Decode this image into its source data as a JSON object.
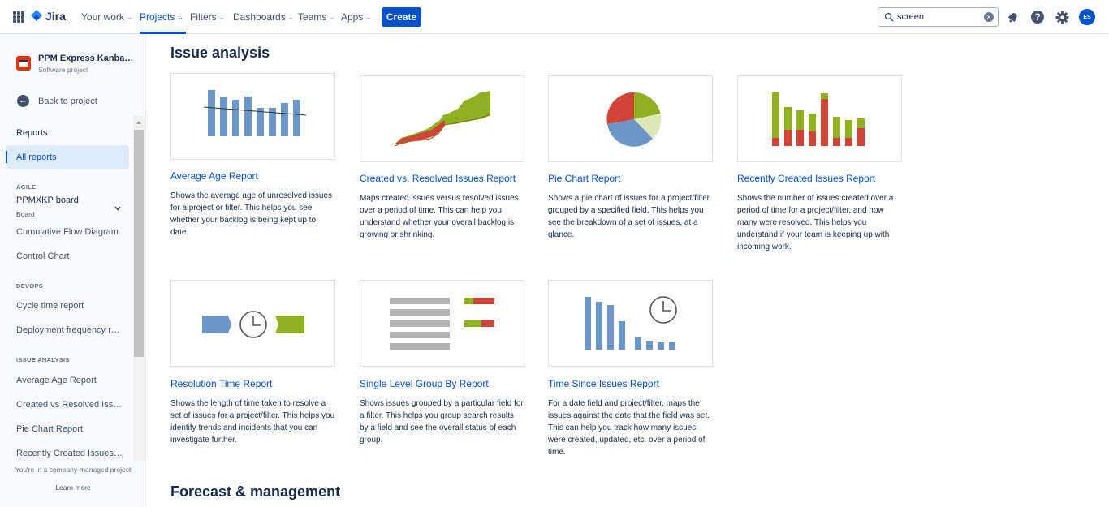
{
  "topnav": {
    "logo": "Jira",
    "items": [
      {
        "label": "Your work"
      },
      {
        "label": "Projects"
      },
      {
        "label": "Filters"
      },
      {
        "label": "Dashboards"
      },
      {
        "label": "Teams"
      },
      {
        "label": "Apps"
      }
    ],
    "active_item": "Projects",
    "create_label": "Create",
    "search_value": "screen",
    "avatar_initials": "ES",
    "colors": {
      "brand": "#0052cc",
      "text": "#42526e"
    }
  },
  "sidebar": {
    "project_name": "PPM Express Kanban Pr...",
    "project_type": "Software project",
    "back_label": "Back to project",
    "reports_label": "Reports",
    "all_reports_label": "All reports",
    "agile_heading": "AGILE",
    "board_name": "PPMXKP board",
    "board_type": "Board",
    "cumulative_flow": "Cumulative Flow Diagram",
    "control_chart": "Control Chart",
    "devops_heading": "DEVOPS",
    "cycle_time": "Cycle time report",
    "deployment_frequency": "Deployment frequency re...",
    "issue_analysis_heading": "ISSUE ANALYSIS",
    "average_age": "Average Age Report",
    "created_vs_resolved": "Created vs Resolved Issue...",
    "pie_chart": "Pie Chart Report",
    "recently_created": "Recently Created Issues Re...",
    "footer_text": "You're in a company-managed project",
    "learn_more": "Learn more"
  },
  "main": {
    "section_issue_analysis": "Issue analysis",
    "section_forecast": "Forecast & management",
    "cards": [
      {
        "title": "Average Age Report",
        "desc": "Shows the average age of unresolved issues for a project or filter. This helps you see whether your backlog is being kept up to date."
      },
      {
        "title": "Created vs. Resolved Issues Report",
        "desc": "Maps created issues versus resolved issues over a period of time. This can help you understand whether your overall backlog is growing or shrinking."
      },
      {
        "title": "Pie Chart Report",
        "desc": "Shows a pie chart of issues for a project/filter grouped by a specified field. This helps you see the breakdown of a set of issues, at a glance."
      },
      {
        "title": "Recently Created Issues Report",
        "desc": "Shows the number of issues created over a period of time for a project/filter, and how many were resolved. This helps you understand if your team is keeping up with incoming work."
      },
      {
        "title": "Resolution Time Report",
        "desc": "Shows the length of time taken to resolve a set of issues for a project/filter. This helps you identify trends and incidents that you can investigate further."
      },
      {
        "title": "Single Level Group By Report",
        "desc": "Shows issues grouped by a particular field for a filter. This helps you group search results by a field and see the overall status of each group."
      },
      {
        "title": "Time Since Issues Report",
        "desc": "For a date field and project/filter, maps the issues against the date that the field was set. This can help you track how many issues were created, updated, etc, over a period of time."
      }
    ],
    "colors": {
      "blue": "#6b96c7",
      "green": "#8fb021",
      "red": "#d04437",
      "gray": "#b3b3b3"
    }
  }
}
